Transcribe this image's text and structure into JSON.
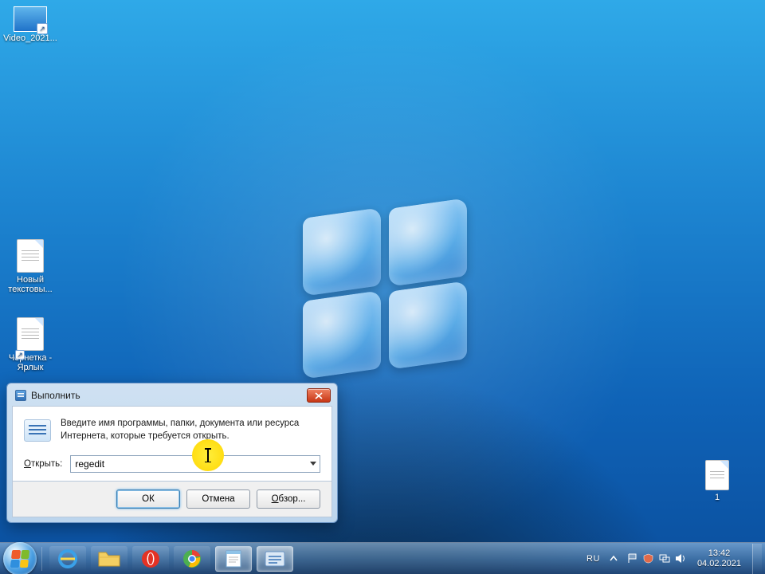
{
  "desktop": {
    "icons": {
      "video": "Video_2021...",
      "newtext": "Новый текстовы...",
      "draft_shortcut": "Чернетка - Ярлык",
      "one": "1"
    }
  },
  "run_dialog": {
    "title": "Выполнить",
    "instruction": "Введите имя программы, папки, документа или ресурса Интернета, которые требуется открыть.",
    "open_label_prefix": "О",
    "open_label_rest": "ткрыть:",
    "input_value": "regedit",
    "buttons": {
      "ok": "ОК",
      "cancel": "Отмена",
      "browse": "Обзор..."
    }
  },
  "taskbar": {
    "lang": "RU",
    "time": "13:42",
    "date": "04.02.2021"
  }
}
